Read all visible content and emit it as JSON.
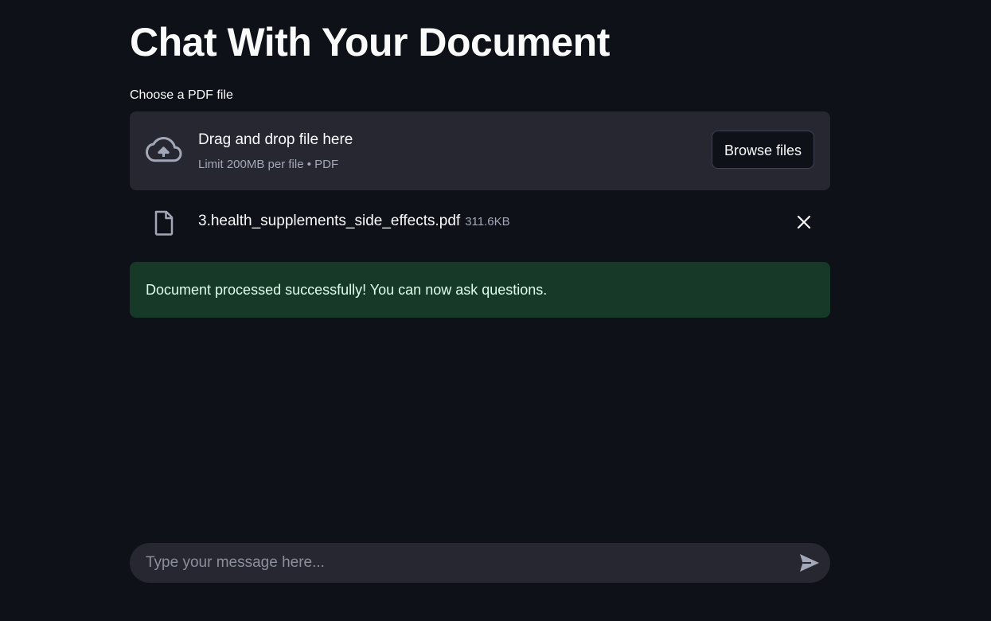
{
  "page": {
    "title": "Chat With Your Document"
  },
  "uploader": {
    "label": "Choose a PDF file",
    "drop_text": "Drag and drop file here",
    "limit_text": "Limit 200MB per file • PDF",
    "browse_label": "Browse files",
    "icon": "cloud-upload-icon"
  },
  "uploaded_file": {
    "name": "3.health_supplements_side_effects.pdf",
    "size": "311.6KB",
    "icon": "file-icon",
    "remove_icon": "close-icon"
  },
  "alert": {
    "message": "Document processed successfully! You can now ask questions.",
    "type": "success",
    "background": "#173928",
    "text_color": "#dffde9"
  },
  "chat": {
    "placeholder": "Type your message here...",
    "value": "",
    "send_icon": "send-icon"
  },
  "colors": {
    "background": "#0e1117",
    "surface": "#262730",
    "text": "#fafafa",
    "muted_text": "#a3a8b8"
  }
}
